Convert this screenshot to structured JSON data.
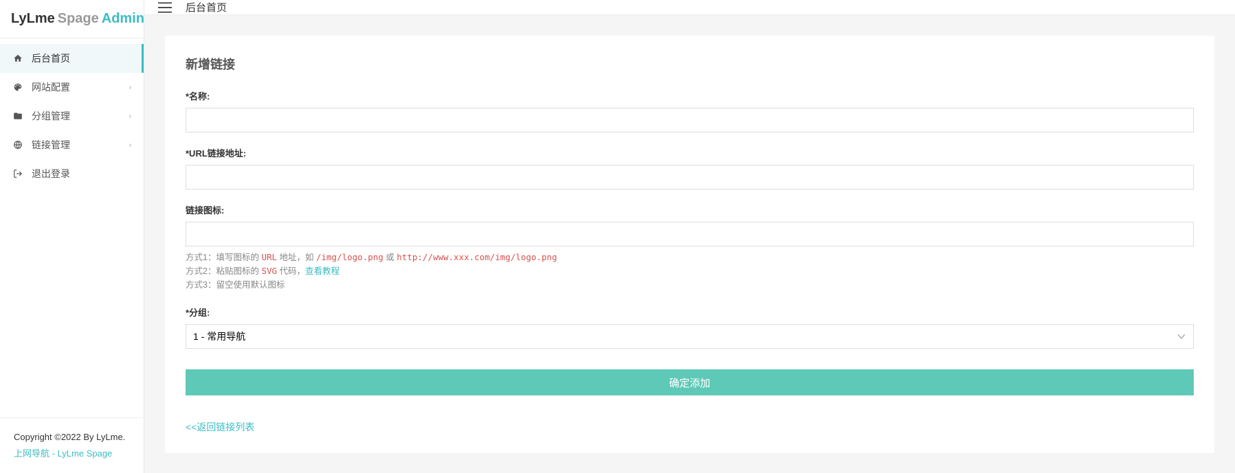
{
  "logo": {
    "part1": "LyLme",
    "part2": "Spage",
    "part3": "Admin"
  },
  "topbar": {
    "breadcrumb": "后台首页"
  },
  "sidebar": {
    "items": [
      {
        "label": "后台首页",
        "icon": "home",
        "arrow": false,
        "active": true
      },
      {
        "label": "网站配置",
        "icon": "palette",
        "arrow": true,
        "active": false
      },
      {
        "label": "分组管理",
        "icon": "folder",
        "arrow": true,
        "active": false
      },
      {
        "label": "链接管理",
        "icon": "globe",
        "arrow": true,
        "active": false
      },
      {
        "label": "退出登录",
        "icon": "logout",
        "arrow": false,
        "active": false
      }
    ]
  },
  "footer": {
    "copyright": "Copyright ©2022 By LyLme.",
    "link_text": "上网导航 - LyLme Spage"
  },
  "form": {
    "title": "新增链接",
    "name_label": "*名称:",
    "name_value": "",
    "url_label": "*URL链接地址:",
    "url_value": "",
    "icon_label": "链接图标:",
    "icon_value": "",
    "hints": {
      "l1_pre": "方式1：填写图标的 ",
      "l1_code1": "URL",
      "l1_mid": " 地址，如 ",
      "l1_code2": "/img/logo.png",
      "l1_or": " 或 ",
      "l1_code3": "http://www.xxx.com/img/logo.png",
      "l2_pre": "方式2：粘贴图标的 ",
      "l2_code": "SVG",
      "l2_post": " 代码，",
      "l2_link": "查看教程",
      "l3": "方式3：留空使用默认图标"
    },
    "group_label": "*分组:",
    "group_value": "1 - 常用导航",
    "submit": "确定添加",
    "back_link": "<<返回链接列表"
  }
}
